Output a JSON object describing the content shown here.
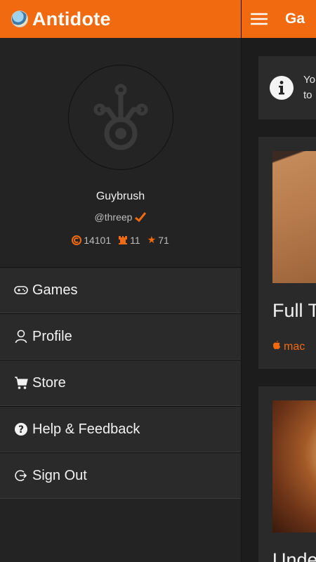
{
  "app": {
    "title": "Antidote"
  },
  "profile": {
    "username": "Guybrush",
    "handle": "@threep",
    "stats": {
      "coins": "14101",
      "trophies": "11",
      "stars": "71"
    }
  },
  "menu": {
    "items": [
      {
        "label": "Games",
        "icon": "gamepad-icon"
      },
      {
        "label": "Profile",
        "icon": "user-icon"
      },
      {
        "label": "Store",
        "icon": "cart-icon"
      },
      {
        "label": "Help & Feedback",
        "icon": "question-circle-icon"
      },
      {
        "label": "Sign Out",
        "icon": "sign-out-icon"
      }
    ]
  },
  "main": {
    "title": "Ga",
    "notice_line1": "Yo",
    "notice_line2": "to",
    "cards": [
      {
        "title": "Full T",
        "platform": "mac"
      },
      {
        "title": "Unde"
      }
    ]
  },
  "colors": {
    "accent": "#f26a10",
    "drawer_bg": "#232323",
    "menu_bg": "#2a2a2a"
  }
}
